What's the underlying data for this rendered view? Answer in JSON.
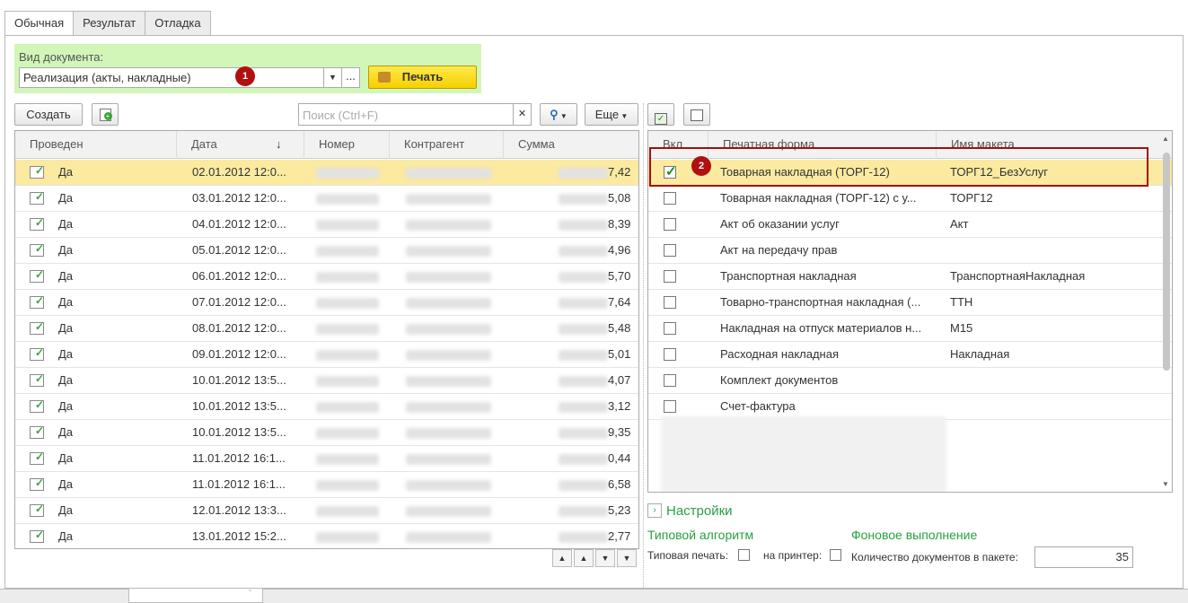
{
  "tabs": [
    "Обычная",
    "Результат",
    "Отладка"
  ],
  "doc_type": {
    "label": "Вид документа:",
    "value": "Реализация (акты, накладные)",
    "more": "..."
  },
  "print_label": "Печать",
  "markers": {
    "m1": "1",
    "m2": "2"
  },
  "toolbar": {
    "create": "Создать",
    "search_placeholder": "Поиск (Ctrl+F)",
    "more": "Еще"
  },
  "docs": {
    "columns": [
      "Проведен",
      "Дата",
      "Номер",
      "Контрагент",
      "Сумма"
    ],
    "rows": [
      {
        "posted": "Да",
        "date": "02.01.2012 12:0...",
        "sum_tail": "7,42"
      },
      {
        "posted": "Да",
        "date": "03.01.2012 12:0...",
        "sum_tail": "5,08"
      },
      {
        "posted": "Да",
        "date": "04.01.2012 12:0...",
        "sum_tail": "8,39"
      },
      {
        "posted": "Да",
        "date": "05.01.2012 12:0...",
        "sum_tail": "4,96"
      },
      {
        "posted": "Да",
        "date": "06.01.2012 12:0...",
        "sum_tail": "5,70"
      },
      {
        "posted": "Да",
        "date": "07.01.2012 12:0...",
        "sum_tail": "7,64"
      },
      {
        "posted": "Да",
        "date": "08.01.2012 12:0...",
        "sum_tail": "5,48"
      },
      {
        "posted": "Да",
        "date": "09.01.2012 12:0...",
        "sum_tail": "5,01"
      },
      {
        "posted": "Да",
        "date": "10.01.2012 13:5...",
        "sum_tail": "4,07"
      },
      {
        "posted": "Да",
        "date": "10.01.2012 13:5...",
        "sum_tail": "3,12"
      },
      {
        "posted": "Да",
        "date": "10.01.2012 13:5...",
        "sum_tail": "9,35"
      },
      {
        "posted": "Да",
        "date": "11.01.2012 16:1...",
        "sum_tail": "0,44"
      },
      {
        "posted": "Да",
        "date": "11.01.2012 16:1...",
        "sum_tail": "6,58"
      },
      {
        "posted": "Да",
        "date": "12.01.2012 13:3...",
        "sum_tail": "5,23"
      },
      {
        "posted": "Да",
        "date": "13.01.2012 15:2...",
        "sum_tail": "2,77"
      }
    ]
  },
  "forms": {
    "columns": [
      "Вкл",
      "Печатная форма",
      "Имя макета"
    ],
    "rows": [
      {
        "checked": true,
        "name": "Товарная накладная (ТОРГ-12)",
        "template": "ТОРГ12_БезУслуг"
      },
      {
        "checked": false,
        "name": "Товарная накладная (ТОРГ-12) с у...",
        "template": "ТОРГ12"
      },
      {
        "checked": false,
        "name": "Акт об оказании услуг",
        "template": "Акт"
      },
      {
        "checked": false,
        "name": "Акт на передачу прав",
        "template": ""
      },
      {
        "checked": false,
        "name": "Транспортная накладная",
        "template": "ТранспортнаяНакладная"
      },
      {
        "checked": false,
        "name": "Товарно-транспортная накладная (...",
        "template": "ТТН"
      },
      {
        "checked": false,
        "name": "Накладная на отпуск материалов н...",
        "template": "М15"
      },
      {
        "checked": false,
        "name": "Расходная накладная",
        "template": "Накладная"
      },
      {
        "checked": false,
        "name": "Комплект документов",
        "template": ""
      },
      {
        "checked": false,
        "name": "Счет-фактура",
        "template": ""
      }
    ]
  },
  "settings": {
    "title": "Настройки",
    "typical": "Типовой алгоритм",
    "background": "Фоновое выполнение",
    "typical_print": "Типовая печать:",
    "to_printer": "на принтер:",
    "batch_label": "Количество документов в пакете:",
    "batch_value": "35"
  },
  "colors": {
    "accent_green": "#28a040",
    "selection": "#fbeaa0",
    "print_button": "#ffe94d",
    "marker": "#b01010"
  }
}
